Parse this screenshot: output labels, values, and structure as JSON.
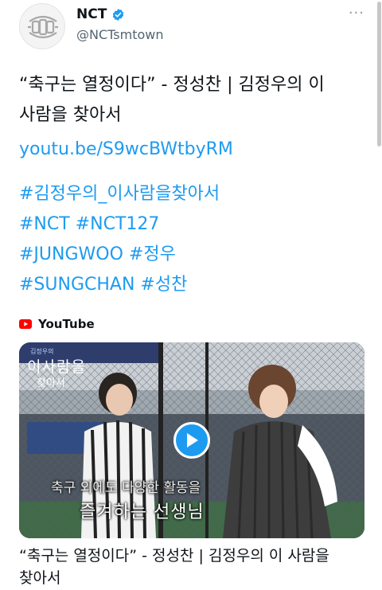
{
  "account": {
    "display_name": "NCT",
    "handle": "@NCTsmtown",
    "verified_icon": "verified-badge-icon",
    "avatar_icon": "nct-logo-icon",
    "more_icon": "more-dots-icon",
    "more_glyph": "···"
  },
  "tweet": {
    "text_line1": "“축구는 열정이다” - 정성찬 | 김정우의 이",
    "text_line2": "사람을 찾아서",
    "link": "youtu.be/S9wcBWtbyRM",
    "hashtags": [
      "#김정우의_이사람을찾아서",
      "#NCT #NCT127",
      "#JUNGWOO #정우",
      "#SUNGCHAN #성찬"
    ]
  },
  "card": {
    "source": "YouTube",
    "source_icon": "youtube-icon",
    "play_icon": "play-icon",
    "overlay_top": "김정우의",
    "overlay_title": "이사람을",
    "overlay_sub": "찾아서",
    "subtitle_line1": "축구 외에도 다양한 활동을",
    "subtitle_line2": "즐겨하는 선생님",
    "title_line1": "“축구는 열정이다” - 정성찬 | 김정우의 이 사람을",
    "title_line2": "찾아서"
  },
  "colors": {
    "link": "#1d9bf0",
    "text": "#0f1419",
    "secondary": "#536471",
    "youtube_red": "#ff0000"
  }
}
